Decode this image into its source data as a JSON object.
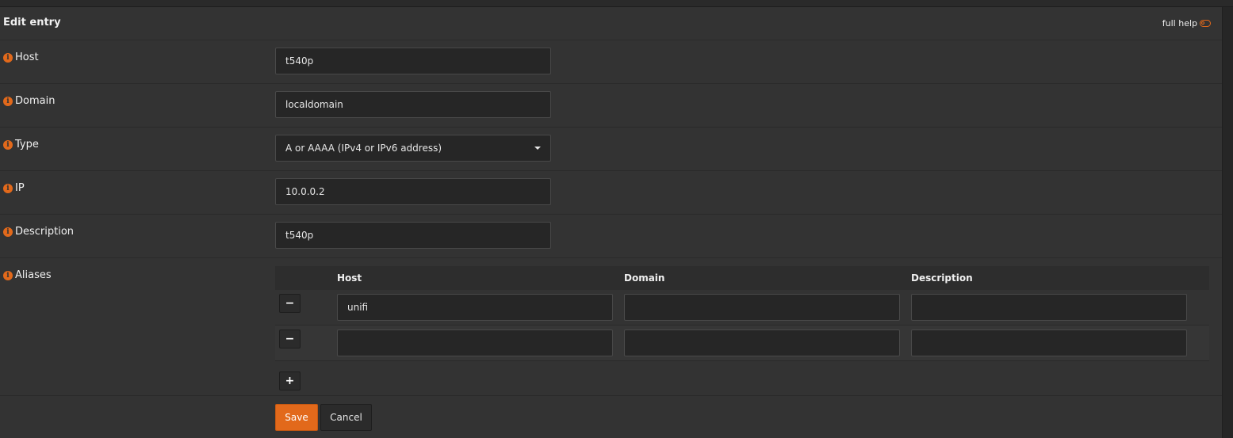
{
  "panel": {
    "title": "Edit entry",
    "full_help_label": "full help"
  },
  "fields": {
    "host": {
      "label": "Host",
      "value": "t540p"
    },
    "domain": {
      "label": "Domain",
      "value": "localdomain"
    },
    "type": {
      "label": "Type",
      "value": "A or AAAA (IPv4 or IPv6 address)"
    },
    "ip": {
      "label": "IP",
      "value": "10.0.0.2"
    },
    "description": {
      "label": "Description",
      "value": "t540p"
    },
    "aliases": {
      "label": "Aliases"
    }
  },
  "aliases_table": {
    "columns": [
      "Host",
      "Domain",
      "Description"
    ],
    "rows": [
      {
        "host": "unifi",
        "domain": "",
        "description": ""
      },
      {
        "host": "",
        "domain": "",
        "description": ""
      }
    ],
    "remove_label": "−",
    "add_label": "+"
  },
  "actions": {
    "save_label": "Save",
    "cancel_label": "Cancel"
  },
  "colors": {
    "accent": "#e2691b",
    "panel_bg": "#333333",
    "input_bg": "#262626"
  }
}
